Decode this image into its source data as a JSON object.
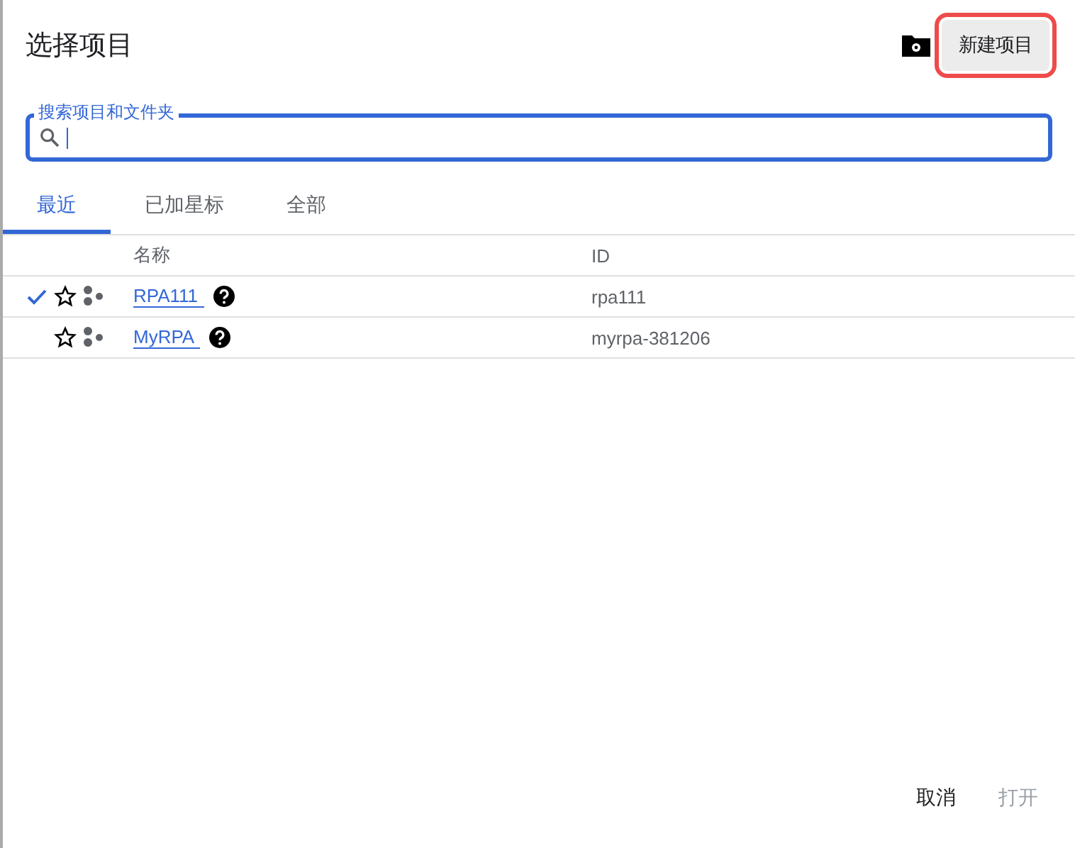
{
  "dialog": {
    "title": "选择项目",
    "new_project_button": {
      "label": "新建项目",
      "highlighted": true
    }
  },
  "search": {
    "label": "搜索项目和文件夹",
    "focused": true
  },
  "tabs": [
    {
      "label": "最近",
      "selected": true
    },
    {
      "label": "已加星标",
      "selected": false
    },
    {
      "label": "全部",
      "selected": false
    }
  ],
  "table": {
    "columns": [
      "名称",
      "ID"
    ],
    "rows": [
      {
        "name": "RPA111",
        "id": "rpa111",
        "selected": true,
        "starred": false
      },
      {
        "name": "MyRPA",
        "id": "myrpa-381206",
        "selected": false,
        "starred": false
      }
    ]
  },
  "buttons": [
    {
      "label": "取消",
      "disabled": false
    },
    {
      "label": "打开",
      "disabled": true
    }
  ]
}
